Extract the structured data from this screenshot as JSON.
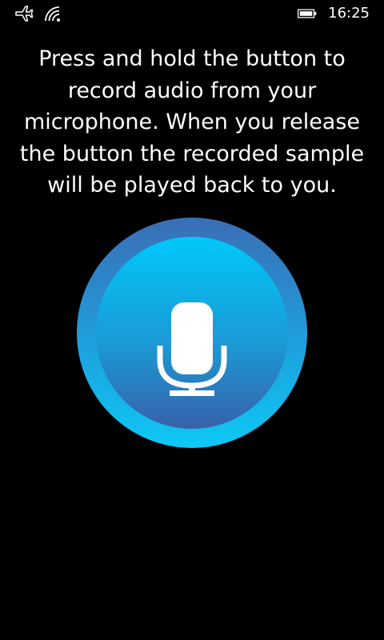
{
  "status_bar": {
    "icons": [
      "airplane-mode-icon",
      "wifi-icon",
      "battery-icon"
    ],
    "time": "16:25"
  },
  "main": {
    "instructions": "Press and hold the button to record audio from your microphone. When you release the button the recorded sample will be played back to you.",
    "record_button": {
      "icon": "microphone-icon"
    }
  },
  "colors": {
    "background": "#000000",
    "text": "#ffffff",
    "button_blue_dark": "#3761a9",
    "button_blue_light": "#00c8fa"
  }
}
